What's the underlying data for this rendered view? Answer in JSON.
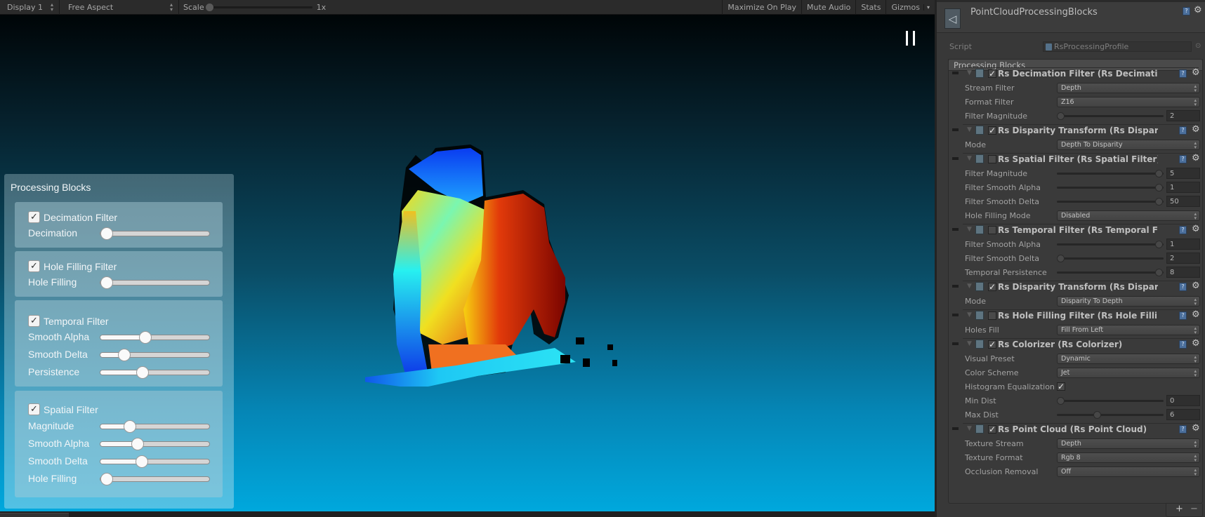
{
  "game_toolbar": {
    "display": "Display 1",
    "aspect": "Free Aspect",
    "scale_label": "Scale",
    "scale_value": "1x",
    "buttons": [
      "Maximize On Play",
      "Mute Audio",
      "Stats",
      "Gizmos"
    ]
  },
  "viewport": {
    "play_state_icon": "pause-icon",
    "colors": {
      "top": "#000507",
      "bottom": "#00a8dd"
    }
  },
  "overlay": {
    "title": "Processing Blocks",
    "groups": [
      {
        "label": "Decimation Filter",
        "checked": true,
        "sliders": [
          {
            "label": "Decimation",
            "value": 0.0
          }
        ]
      },
      {
        "label": "Hole Filling Filter",
        "checked": true,
        "sliders": [
          {
            "label": "Hole Filling",
            "value": 0.0
          }
        ]
      },
      {
        "label": "Temporal Filter",
        "checked": true,
        "sliders": [
          {
            "label": "Smooth Alpha",
            "value": 0.41
          },
          {
            "label": "Smooth Delta",
            "value": 0.22
          },
          {
            "label": "Persistence",
            "value": 0.39
          }
        ]
      },
      {
        "label": "Spatial Filter",
        "checked": true,
        "sliders": [
          {
            "label": "Magnitude",
            "value": 0.27
          },
          {
            "label": "Smooth Alpha",
            "value": 0.34
          },
          {
            "label": "Smooth Delta",
            "value": 0.38
          },
          {
            "label": "Hole Filling",
            "value": 0.0
          }
        ]
      }
    ]
  },
  "inspector": {
    "object_name": "PointCloudProcessingBlocks",
    "script_label": "Script",
    "script_value": "RsProcessingProfile",
    "list_header": "Processing Blocks",
    "blocks": [
      {
        "title": "Rs Decimation Filter (Rs Decimation",
        "enabled": true,
        "props": [
          {
            "label": "Stream Filter",
            "type": "dropdown",
            "value": "Depth"
          },
          {
            "label": "Format Filter",
            "type": "dropdown",
            "value": "Z16"
          },
          {
            "label": "Filter Magnitude",
            "type": "slider",
            "value": "2",
            "fraction": 0.0
          }
        ]
      },
      {
        "title": "Rs Disparity Transform (Rs Disparit",
        "enabled": true,
        "props": [
          {
            "label": "Mode",
            "type": "dropdown",
            "value": "Depth To Disparity"
          }
        ]
      },
      {
        "title": "Rs Spatial Filter (Rs Spatial Filter)",
        "enabled": false,
        "props": [
          {
            "label": "Filter Magnitude",
            "type": "slider",
            "value": "5",
            "fraction": 1.0
          },
          {
            "label": "Filter Smooth Alpha",
            "type": "slider",
            "value": "1",
            "fraction": 1.0
          },
          {
            "label": "Filter Smooth Delta",
            "type": "slider",
            "value": "50",
            "fraction": 1.0
          },
          {
            "label": "Hole Filling Mode",
            "type": "dropdown",
            "value": "Disabled"
          }
        ]
      },
      {
        "title": "Rs Temporal Filter (Rs Temporal Fil",
        "enabled": false,
        "props": [
          {
            "label": "Filter Smooth Alpha",
            "type": "slider",
            "value": "1",
            "fraction": 1.0
          },
          {
            "label": "Filter Smooth Delta",
            "type": "slider",
            "value": "2",
            "fraction": 0.0
          },
          {
            "label": "Temporal Persistence",
            "type": "slider",
            "value": "8",
            "fraction": 1.0
          }
        ]
      },
      {
        "title": "Rs Disparity Transform (Rs Disparit",
        "enabled": true,
        "props": [
          {
            "label": "Mode",
            "type": "dropdown",
            "value": "Disparity To Depth"
          }
        ]
      },
      {
        "title": "Rs Hole Filling Filter (Rs Hole Filling",
        "enabled": false,
        "props": [
          {
            "label": "Holes Fill",
            "type": "dropdown",
            "value": "Fill From Left"
          }
        ]
      },
      {
        "title": "Rs Colorizer (Rs Colorizer)",
        "enabled": true,
        "props": [
          {
            "label": "Visual Preset",
            "type": "dropdown",
            "value": "Dynamic"
          },
          {
            "label": "Color Scheme",
            "type": "dropdown",
            "value": "Jet"
          },
          {
            "label": "Histogram Equalization",
            "type": "toggle",
            "value": true
          },
          {
            "label": "Min Dist",
            "type": "slider",
            "value": "0",
            "fraction": 0.0
          },
          {
            "label": "Max Dist",
            "type": "slider",
            "value": "6",
            "fraction": 0.37
          }
        ]
      },
      {
        "title": "Rs Point Cloud (Rs Point Cloud)",
        "enabled": true,
        "props": [
          {
            "label": "Texture Stream",
            "type": "dropdown",
            "value": "Depth"
          },
          {
            "label": "Texture Format",
            "type": "dropdown",
            "value": "Rgb 8"
          },
          {
            "label": "Occlusion Removal",
            "type": "dropdown",
            "value": "Off"
          }
        ]
      }
    ],
    "footer": {
      "add": "+",
      "remove": "−"
    }
  }
}
